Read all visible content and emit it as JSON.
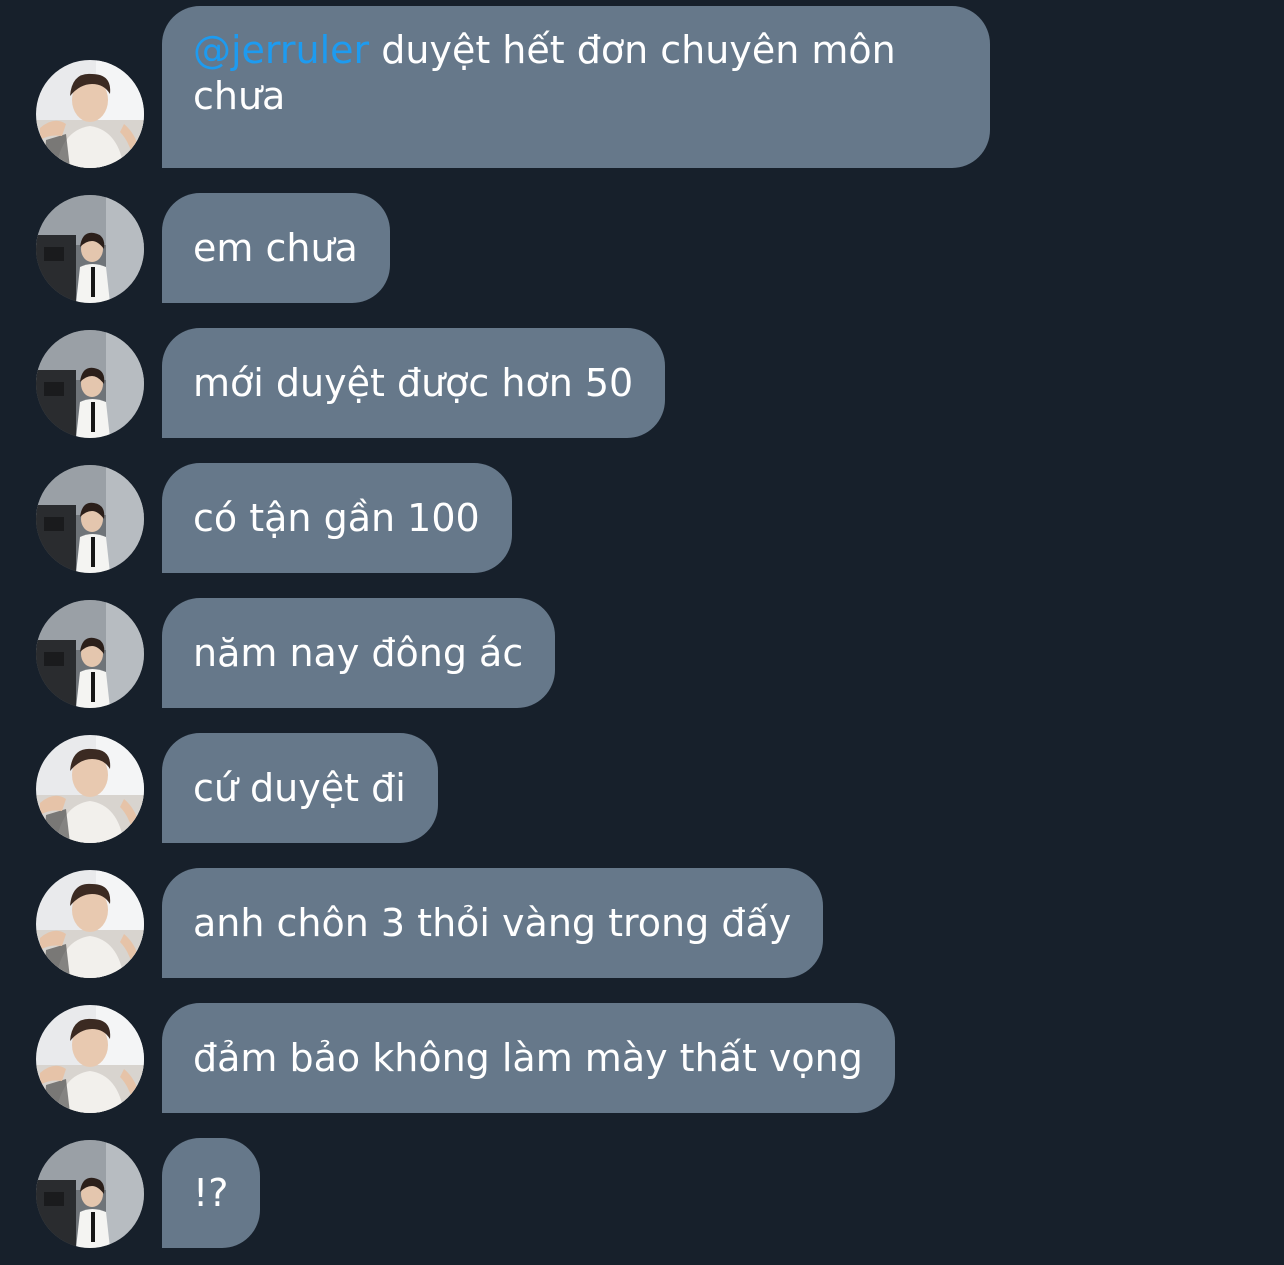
{
  "colors": {
    "background": "#17202b",
    "bubble": "#66788a",
    "text": "#ffffff",
    "mention": "#1d9bf0"
  },
  "messages": [
    {
      "sender": "avatar-a",
      "mention": "@jerruler",
      "text": " duyệt hết đơn chuyên môn chưa"
    },
    {
      "sender": "avatar-b",
      "text": "em chưa"
    },
    {
      "sender": "avatar-b",
      "text": "mới duyệt được hơn 50"
    },
    {
      "sender": "avatar-b",
      "text": "có tận gần 100"
    },
    {
      "sender": "avatar-b",
      "text": "năm nay đông ác"
    },
    {
      "sender": "avatar-a",
      "text": "cứ duyệt đi"
    },
    {
      "sender": "avatar-a",
      "text": "anh chôn 3 thỏi vàng trong đấy"
    },
    {
      "sender": "avatar-a",
      "text": "đảm bảo không làm mày thất vọng"
    },
    {
      "sender": "avatar-b",
      "text": "!?"
    }
  ]
}
